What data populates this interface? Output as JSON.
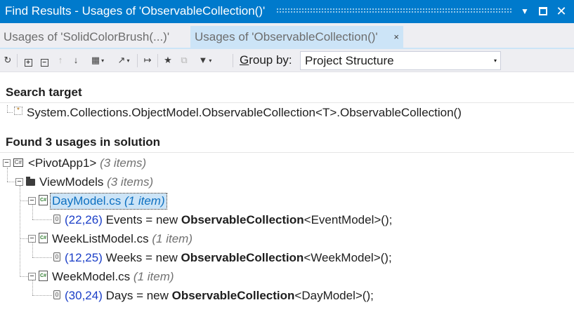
{
  "window": {
    "title": "Find Results - Usages of 'ObservableCollection()'",
    "dropdown_glyph": "▼",
    "close_glyph": "✕"
  },
  "tabs": [
    {
      "label": "Usages of 'SolidColorBrush(...)'",
      "active": false
    },
    {
      "label": "Usages of 'ObservableCollection()'",
      "active": true,
      "close_glyph": "×"
    }
  ],
  "toolbar": {
    "buttons": [
      {
        "name": "refresh-icon",
        "glyph": "↻",
        "enabled": true
      },
      {
        "name": "expand-all-icon",
        "glyph": "+",
        "enabled": true
      },
      {
        "name": "collapse-all-icon",
        "glyph": "−",
        "enabled": true
      },
      {
        "name": "previous-result-icon",
        "glyph": "↑",
        "enabled": false
      },
      {
        "name": "next-result-icon",
        "glyph": "↓",
        "enabled": true
      },
      {
        "name": "show-preview-icon",
        "glyph": "▦",
        "enabled": true
      },
      {
        "name": "export-icon",
        "glyph": "↗",
        "enabled": true
      },
      {
        "name": "goto-icon",
        "glyph": "↦",
        "enabled": true
      },
      {
        "name": "pin-icon",
        "glyph": "★",
        "enabled": true
      },
      {
        "name": "copy-icon",
        "glyph": "⧉",
        "enabled": false
      },
      {
        "name": "filter-icon",
        "glyph": "▼",
        "enabled": true
      }
    ],
    "dropdown_glyph": "▾",
    "group_by_label_accesskey": "G",
    "group_by_label_rest": "roup by:",
    "group_by_value": "Project Structure"
  },
  "search_target": {
    "heading": "Search target",
    "value": "System.Collections.ObjectModel.ObservableCollection<T>.ObservableCollection()"
  },
  "results": {
    "heading": "Found 3 usages in solution",
    "project": {
      "name": "<PivotApp1>",
      "count": "(3 items)"
    },
    "folder": {
      "name": "ViewModels",
      "count": "(3 items)"
    },
    "files": [
      {
        "name": "DayModel.cs",
        "count": "(1 item)",
        "selected": true,
        "usage": {
          "position": "(22,26)",
          "prefix": "Events = new ",
          "method": "ObservableCollection",
          "suffix": "<EventModel>();"
        }
      },
      {
        "name": "WeekListModel.cs",
        "count": "(1 item)",
        "selected": false,
        "usage": {
          "position": "(12,25)",
          "prefix": "Weeks = new ",
          "method": "ObservableCollection",
          "suffix": "<WeekModel>();"
        }
      },
      {
        "name": "WeekModel.cs",
        "count": "(1 item)",
        "selected": false,
        "usage": {
          "position": "(30,24)",
          "prefix": "Days = new ",
          "method": "ObservableCollection",
          "suffix": "<DayModel>();"
        }
      }
    ],
    "icons": {
      "cs_badge": "C#",
      "usage_badge": "0"
    }
  },
  "colors": {
    "accent": "#007acc",
    "tab_active": "#cce4f7",
    "position_text": "#1a3ec7",
    "selection": "#cce4f7"
  }
}
